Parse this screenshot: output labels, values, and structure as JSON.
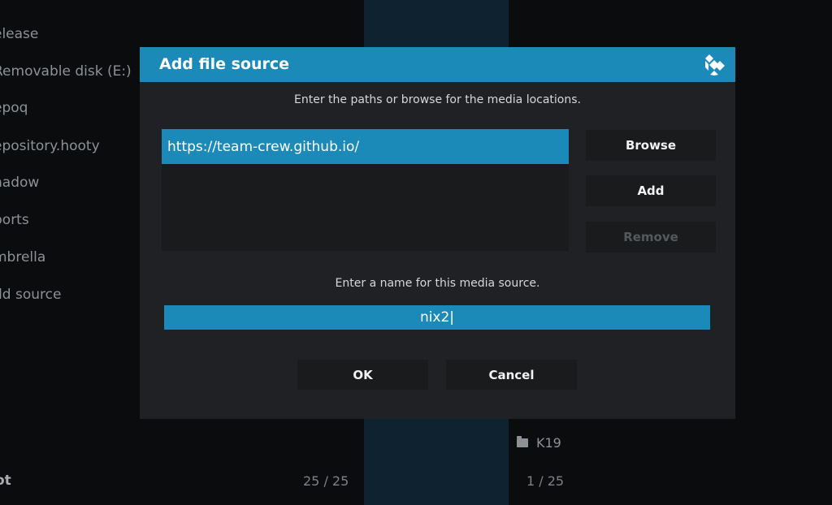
{
  "background": {
    "list_items": [
      "elease",
      "Removable disk (E:)",
      "epoq",
      "epository.hooty",
      "hadow",
      "ports",
      "mbrella",
      "dd source"
    ],
    "footer_left": "ot",
    "footer_mid_count": "25 / 25",
    "footer_right_count": "1 / 25",
    "folder_label": "K19"
  },
  "dialog": {
    "title": "Add file source",
    "paths_instruction": "Enter the paths or browse for the media locations.",
    "paths": [
      "https://team-crew.github.io/"
    ],
    "buttons": {
      "browse": "Browse",
      "add": "Add",
      "remove": "Remove"
    },
    "name_instruction": "Enter a name for this media source.",
    "name_value": "nix2|",
    "ok_label": "OK",
    "cancel_label": "Cancel"
  },
  "colors": {
    "accent": "#1c8ab8",
    "dialog_bg": "#202124",
    "button_bg": "#1a1b1d"
  }
}
